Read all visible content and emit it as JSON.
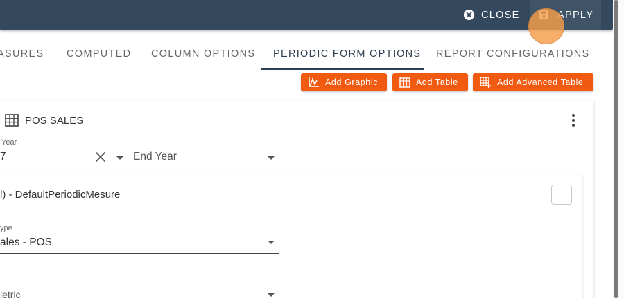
{
  "topbar": {
    "close_label": "CLOSE",
    "apply_label": "APPLY"
  },
  "tabs": [
    {
      "label": "ASURES",
      "active": false
    },
    {
      "label": "COMPUTED",
      "active": false
    },
    {
      "label": "COLUMN OPTIONS",
      "active": false
    },
    {
      "label": "PERIODIC FORM OPTIONS",
      "active": true
    },
    {
      "label": "REPORT CONFIGURATIONS",
      "active": false
    }
  ],
  "actions": {
    "add_graphic": "Add Graphic",
    "add_table": "Add Table",
    "add_advanced_table": "Add Advanced Table"
  },
  "card": {
    "title": "POS SALES",
    "start_year_label": "Year",
    "start_year_value": "7",
    "end_year_placeholder": "End Year"
  },
  "subcard": {
    "title": "l) - DefaultPeriodicMesure",
    "type_label": "ype",
    "type_value": "ales - POS",
    "metric_label": "letric"
  },
  "colors": {
    "topbar": "#34495e",
    "accent_orange": "#f15a11",
    "active_tab": "#2c3e50"
  },
  "icons": {
    "close": "close-circle-icon",
    "apply": "save-icon",
    "graphic": "chart-icon",
    "table": "table-icon",
    "advanced_table": "table-plus-icon",
    "kebab": "more-vert-icon"
  }
}
